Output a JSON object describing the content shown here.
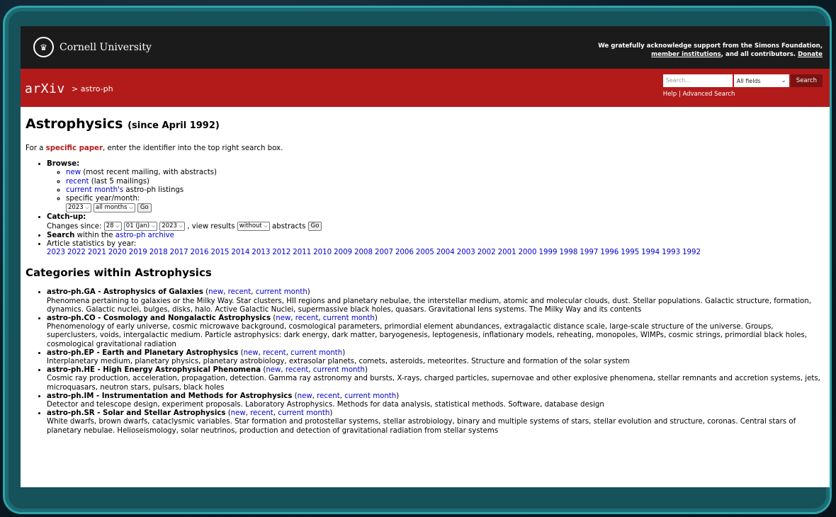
{
  "header": {
    "university": "Cornell University",
    "support_text": "We gratefully acknowledge support from the Simons Foundation,",
    "support_links": [
      "member institutions",
      "Donate"
    ],
    "support_mid": ", and all contributors. "
  },
  "arxivbar": {
    "logo": "arXiv",
    "breadcrumb": "> astro-ph",
    "search_placeholder": "Search...",
    "field_select": "All fields",
    "search_button": "Search",
    "help_link": "Help",
    "separator": "|",
    "advanced_link": "Advanced Search"
  },
  "page": {
    "title": "Astrophysics",
    "since": "(since April 1992)",
    "intro_pre": "For a ",
    "intro_link": "specific paper",
    "intro_post": ", enter the identifier into the top right search box."
  },
  "browse": {
    "label": "Browse:",
    "new_link": "new",
    "new_text": " (most recent mailing, with abstracts)",
    "recent_link": "recent",
    "recent_text": " (last 5 mailings)",
    "current_link": "current month's",
    "current_text": " astro-ph listings",
    "specific_text": "specific year/month:",
    "year_select": "2023",
    "month_select": "all months",
    "go": "Go"
  },
  "catchup": {
    "label": "Catch-up:",
    "changes_since": "Changes since:",
    "day": "28",
    "month": "01 (Jan)",
    "year": "2023",
    "view_results": ", view results",
    "abstracts_select": "without",
    "abstracts_text": "abstracts",
    "go": "Go"
  },
  "search": {
    "label": "Search",
    "within": " within the ",
    "archive_link": "astro-ph archive"
  },
  "stats": {
    "label": "Article statistics by year:",
    "years": [
      "2023",
      "2022",
      "2021",
      "2020",
      "2019",
      "2018",
      "2017",
      "2016",
      "2015",
      "2014",
      "2013",
      "2012",
      "2011",
      "2010",
      "2009",
      "2008",
      "2007",
      "2006",
      "2005",
      "2004",
      "2003",
      "2002",
      "2001",
      "2000",
      "1999",
      "1998",
      "1997",
      "1996",
      "1995",
      "1994",
      "1993",
      "1992"
    ]
  },
  "categories_heading": "Categories within Astrophysics",
  "categories": [
    {
      "code": "astro-ph.GA - Astrophysics of Galaxies",
      "desc": "Phenomena pertaining to galaxies or the Milky Way. Star clusters, HII regions and planetary nebulae, the interstellar medium, atomic and molecular clouds, dust. Stellar populations. Galactic structure, formation, dynamics. Galactic nuclei, bulges, disks, halo. Active Galactic Nuclei, supermassive black holes, quasars. Gravitational lens systems. The Milky Way and its contents"
    },
    {
      "code": "astro-ph.CO - Cosmology and Nongalactic Astrophysics",
      "desc": "Phenomenology of early universe, cosmic microwave background, cosmological parameters, primordial element abundances, extragalactic distance scale, large-scale structure of the universe. Groups, superclusters, voids, intergalactic medium. Particle astrophysics: dark energy, dark matter, baryogenesis, leptogenesis, inflationary models, reheating, monopoles, WIMPs, cosmic strings, primordial black holes, cosmological gravitational radiation"
    },
    {
      "code": "astro-ph.EP - Earth and Planetary Astrophysics",
      "desc": "Interplanetary medium, planetary physics, planetary astrobiology, extrasolar planets, comets, asteroids, meteorites. Structure and formation of the solar system"
    },
    {
      "code": "astro-ph.HE - High Energy Astrophysical Phenomena",
      "desc": "Cosmic ray production, acceleration, propagation, detection. Gamma ray astronomy and bursts, X-rays, charged particles, supernovae and other explosive phenomena, stellar remnants and accretion systems, jets, microquasars, neutron stars, pulsars, black holes"
    },
    {
      "code": "astro-ph.IM - Instrumentation and Methods for Astrophysics",
      "desc": "Detector and telescope design, experiment proposals. Laboratory Astrophysics. Methods for data analysis, statistical methods. Software, database design"
    },
    {
      "code": "astro-ph.SR - Solar and Stellar Astrophysics",
      "desc": "White dwarfs, brown dwarfs, cataclysmic variables. Star formation and protostellar systems, stellar astrobiology, binary and multiple systems of stars, stellar evolution and structure, coronas. Central stars of planetary nebulae. Helioseismology, solar neutrinos, production and detection of gravitational radiation from stellar systems"
    }
  ],
  "category_links": {
    "open": " (",
    "new": "new",
    "comma": ", ",
    "recent": "recent",
    "current": "current month",
    "close": ")"
  },
  "icons": {
    "chevron": "chevron-down-icon",
    "seal": "cornell-seal-icon"
  }
}
